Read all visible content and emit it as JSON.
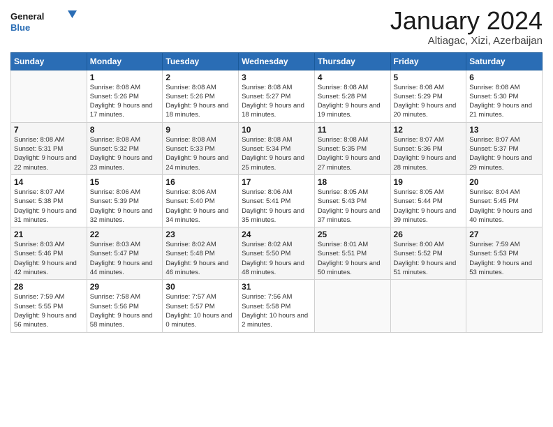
{
  "header": {
    "logo_general": "General",
    "logo_blue": "Blue",
    "month_title": "January 2024",
    "subtitle": "Altiagac, Xizi, Azerbaijan"
  },
  "days_of_week": [
    "Sunday",
    "Monday",
    "Tuesday",
    "Wednesday",
    "Thursday",
    "Friday",
    "Saturday"
  ],
  "weeks": [
    [
      {
        "day": "",
        "sunrise": "",
        "sunset": "",
        "daylight": ""
      },
      {
        "day": "1",
        "sunrise": "Sunrise: 8:08 AM",
        "sunset": "Sunset: 5:26 PM",
        "daylight": "Daylight: 9 hours and 17 minutes."
      },
      {
        "day": "2",
        "sunrise": "Sunrise: 8:08 AM",
        "sunset": "Sunset: 5:26 PM",
        "daylight": "Daylight: 9 hours and 18 minutes."
      },
      {
        "day": "3",
        "sunrise": "Sunrise: 8:08 AM",
        "sunset": "Sunset: 5:27 PM",
        "daylight": "Daylight: 9 hours and 18 minutes."
      },
      {
        "day": "4",
        "sunrise": "Sunrise: 8:08 AM",
        "sunset": "Sunset: 5:28 PM",
        "daylight": "Daylight: 9 hours and 19 minutes."
      },
      {
        "day": "5",
        "sunrise": "Sunrise: 8:08 AM",
        "sunset": "Sunset: 5:29 PM",
        "daylight": "Daylight: 9 hours and 20 minutes."
      },
      {
        "day": "6",
        "sunrise": "Sunrise: 8:08 AM",
        "sunset": "Sunset: 5:30 PM",
        "daylight": "Daylight: 9 hours and 21 minutes."
      }
    ],
    [
      {
        "day": "7",
        "sunrise": "Sunrise: 8:08 AM",
        "sunset": "Sunset: 5:31 PM",
        "daylight": "Daylight: 9 hours and 22 minutes."
      },
      {
        "day": "8",
        "sunrise": "Sunrise: 8:08 AM",
        "sunset": "Sunset: 5:32 PM",
        "daylight": "Daylight: 9 hours and 23 minutes."
      },
      {
        "day": "9",
        "sunrise": "Sunrise: 8:08 AM",
        "sunset": "Sunset: 5:33 PM",
        "daylight": "Daylight: 9 hours and 24 minutes."
      },
      {
        "day": "10",
        "sunrise": "Sunrise: 8:08 AM",
        "sunset": "Sunset: 5:34 PM",
        "daylight": "Daylight: 9 hours and 25 minutes."
      },
      {
        "day": "11",
        "sunrise": "Sunrise: 8:08 AM",
        "sunset": "Sunset: 5:35 PM",
        "daylight": "Daylight: 9 hours and 27 minutes."
      },
      {
        "day": "12",
        "sunrise": "Sunrise: 8:07 AM",
        "sunset": "Sunset: 5:36 PM",
        "daylight": "Daylight: 9 hours and 28 minutes."
      },
      {
        "day": "13",
        "sunrise": "Sunrise: 8:07 AM",
        "sunset": "Sunset: 5:37 PM",
        "daylight": "Daylight: 9 hours and 29 minutes."
      }
    ],
    [
      {
        "day": "14",
        "sunrise": "Sunrise: 8:07 AM",
        "sunset": "Sunset: 5:38 PM",
        "daylight": "Daylight: 9 hours and 31 minutes."
      },
      {
        "day": "15",
        "sunrise": "Sunrise: 8:06 AM",
        "sunset": "Sunset: 5:39 PM",
        "daylight": "Daylight: 9 hours and 32 minutes."
      },
      {
        "day": "16",
        "sunrise": "Sunrise: 8:06 AM",
        "sunset": "Sunset: 5:40 PM",
        "daylight": "Daylight: 9 hours and 34 minutes."
      },
      {
        "day": "17",
        "sunrise": "Sunrise: 8:06 AM",
        "sunset": "Sunset: 5:41 PM",
        "daylight": "Daylight: 9 hours and 35 minutes."
      },
      {
        "day": "18",
        "sunrise": "Sunrise: 8:05 AM",
        "sunset": "Sunset: 5:43 PM",
        "daylight": "Daylight: 9 hours and 37 minutes."
      },
      {
        "day": "19",
        "sunrise": "Sunrise: 8:05 AM",
        "sunset": "Sunset: 5:44 PM",
        "daylight": "Daylight: 9 hours and 39 minutes."
      },
      {
        "day": "20",
        "sunrise": "Sunrise: 8:04 AM",
        "sunset": "Sunset: 5:45 PM",
        "daylight": "Daylight: 9 hours and 40 minutes."
      }
    ],
    [
      {
        "day": "21",
        "sunrise": "Sunrise: 8:03 AM",
        "sunset": "Sunset: 5:46 PM",
        "daylight": "Daylight: 9 hours and 42 minutes."
      },
      {
        "day": "22",
        "sunrise": "Sunrise: 8:03 AM",
        "sunset": "Sunset: 5:47 PM",
        "daylight": "Daylight: 9 hours and 44 minutes."
      },
      {
        "day": "23",
        "sunrise": "Sunrise: 8:02 AM",
        "sunset": "Sunset: 5:48 PM",
        "daylight": "Daylight: 9 hours and 46 minutes."
      },
      {
        "day": "24",
        "sunrise": "Sunrise: 8:02 AM",
        "sunset": "Sunset: 5:50 PM",
        "daylight": "Daylight: 9 hours and 48 minutes."
      },
      {
        "day": "25",
        "sunrise": "Sunrise: 8:01 AM",
        "sunset": "Sunset: 5:51 PM",
        "daylight": "Daylight: 9 hours and 50 minutes."
      },
      {
        "day": "26",
        "sunrise": "Sunrise: 8:00 AM",
        "sunset": "Sunset: 5:52 PM",
        "daylight": "Daylight: 9 hours and 51 minutes."
      },
      {
        "day": "27",
        "sunrise": "Sunrise: 7:59 AM",
        "sunset": "Sunset: 5:53 PM",
        "daylight": "Daylight: 9 hours and 53 minutes."
      }
    ],
    [
      {
        "day": "28",
        "sunrise": "Sunrise: 7:59 AM",
        "sunset": "Sunset: 5:55 PM",
        "daylight": "Daylight: 9 hours and 56 minutes."
      },
      {
        "day": "29",
        "sunrise": "Sunrise: 7:58 AM",
        "sunset": "Sunset: 5:56 PM",
        "daylight": "Daylight: 9 hours and 58 minutes."
      },
      {
        "day": "30",
        "sunrise": "Sunrise: 7:57 AM",
        "sunset": "Sunset: 5:57 PM",
        "daylight": "Daylight: 10 hours and 0 minutes."
      },
      {
        "day": "31",
        "sunrise": "Sunrise: 7:56 AM",
        "sunset": "Sunset: 5:58 PM",
        "daylight": "Daylight: 10 hours and 2 minutes."
      },
      {
        "day": "",
        "sunrise": "",
        "sunset": "",
        "daylight": ""
      },
      {
        "day": "",
        "sunrise": "",
        "sunset": "",
        "daylight": ""
      },
      {
        "day": "",
        "sunrise": "",
        "sunset": "",
        "daylight": ""
      }
    ]
  ]
}
